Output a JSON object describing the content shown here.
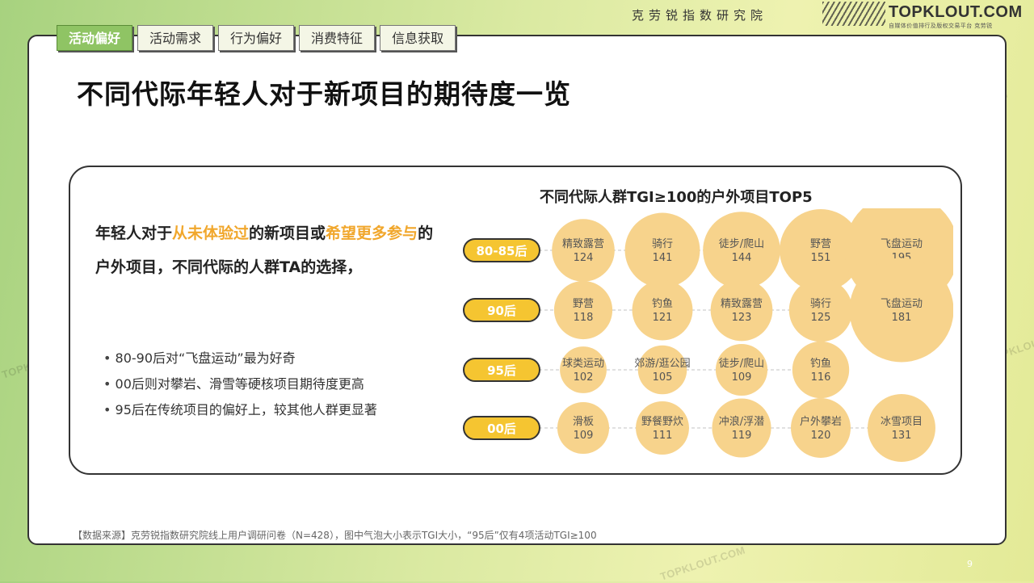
{
  "header": {
    "org": "克劳锐指数研究院",
    "brand": "TOPKLOUT.COM",
    "brand_sub": "自媒体价值排行及版权交易平台 克劳锐"
  },
  "tabs": [
    {
      "label": "活动偏好",
      "active": true
    },
    {
      "label": "活动需求",
      "active": false
    },
    {
      "label": "行为偏好",
      "active": false
    },
    {
      "label": "消费特征",
      "active": false
    },
    {
      "label": "信息获取",
      "active": false
    }
  ],
  "page_title": "不同代际年轻人对于新项目的期待度一览",
  "intro": {
    "p1": "年轻人对于",
    "h1": "从未体验过",
    "p2": "的新项目或",
    "h2": "希望更多参与",
    "p3": "的户外项目，不同代际的人群TA的选择，"
  },
  "bullets": [
    "80-90后对“飞盘运动”最为好奇",
    "00后则对攀岩、滑雪等硬核项目期待度更高",
    "95后在传统项目的偏好上，较其他人群更显著"
  ],
  "chart_data": {
    "type": "bubble",
    "title": "不同代际人群TGI≥100的户外项目TOP5",
    "rows": [
      {
        "group": "80-85后",
        "items": [
          {
            "label": "精致露营",
            "value": 124
          },
          {
            "label": "骑行",
            "value": 141
          },
          {
            "label": "徒步/爬山",
            "value": 144
          },
          {
            "label": "野营",
            "value": 151
          },
          {
            "label": "飞盘运动",
            "value": 195
          }
        ]
      },
      {
        "group": "90后",
        "items": [
          {
            "label": "野营",
            "value": 118
          },
          {
            "label": "钓鱼",
            "value": 121
          },
          {
            "label": "精致露营",
            "value": 123
          },
          {
            "label": "骑行",
            "value": 125
          },
          {
            "label": "飞盘运动",
            "value": 181
          }
        ]
      },
      {
        "group": "95后",
        "items": [
          {
            "label": "球类运动",
            "value": 102
          },
          {
            "label": "郊游/逛公园",
            "value": 105
          },
          {
            "label": "徒步/爬山",
            "value": 109
          },
          {
            "label": "钓鱼",
            "value": 116
          }
        ]
      },
      {
        "group": "00后",
        "items": [
          {
            "label": "滑板",
            "value": 109
          },
          {
            "label": "野餐野炊",
            "value": 111
          },
          {
            "label": "冲浪/浮潜",
            "value": 119
          },
          {
            "label": "户外攀岩",
            "value": 120
          },
          {
            "label": "冰雪项目",
            "value": 131
          }
        ]
      }
    ],
    "colors": {
      "bubble": "#f7d38c",
      "pill": "#f5c531",
      "pill_border": "#333333",
      "pill_text": "#ffffff"
    }
  },
  "source": "【数据来源】克劳锐指数研究院线上用户调研问卷（N=428），图中气泡大小表示TGI大小，“95后”仅有4项活动TGI≥100",
  "page_number": "9",
  "watermark": "TOPKLOUT.COM"
}
